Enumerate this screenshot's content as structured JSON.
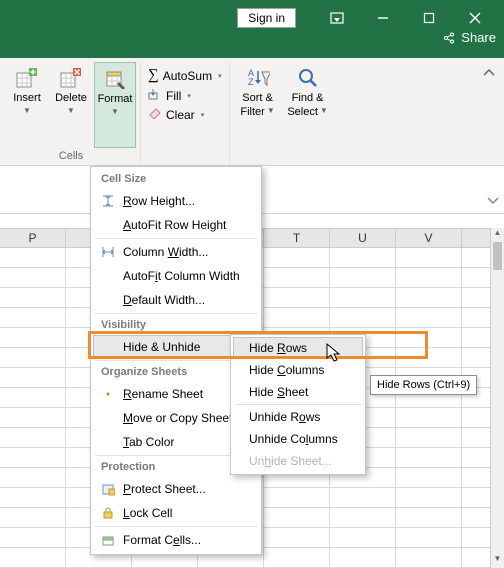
{
  "titlebar": {
    "signin": "Sign in"
  },
  "share": {
    "label": "Share"
  },
  "ribbon": {
    "insert": "Insert",
    "delete": "Delete",
    "format": "Format",
    "autosum": "AutoSum",
    "fill": "Fill",
    "clear": "Clear",
    "sortfilter_l1": "Sort &",
    "sortfilter_l2": "Filter",
    "findselect_l1": "Find &",
    "findselect_l2": "Select",
    "group_cells": "Cells"
  },
  "columns": [
    "P",
    "",
    "",
    "",
    "T",
    "U",
    "V"
  ],
  "menu": {
    "hdr_cellsize": "Cell Size",
    "row_height": "Row Height...",
    "autofit_row": "AutoFit Row Height",
    "col_width": "Column Width...",
    "autofit_col": "AutoFit Column Width",
    "default_width": "Default Width...",
    "hdr_visibility": "Visibility",
    "hide_unhide": "Hide & Unhide",
    "hdr_organize": "Organize Sheets",
    "rename_sheet": "Rename Sheet",
    "move_copy": "Move or Copy Sheet...",
    "tab_color": "Tab Color",
    "hdr_protection": "Protection",
    "protect_sheet": "Protect Sheet...",
    "lock_cell": "Lock Cell",
    "format_cells": "Format Cells..."
  },
  "submenu": {
    "hide_rows": "Hide Rows",
    "hide_cols": "Hide Columns",
    "hide_sheet": "Hide Sheet",
    "unhide_rows": "Unhide Rows",
    "unhide_cols": "Unhide Columns",
    "unhide_sheet": "Unhide Sheet..."
  },
  "tooltip": "Hide Rows (Ctrl+9)"
}
